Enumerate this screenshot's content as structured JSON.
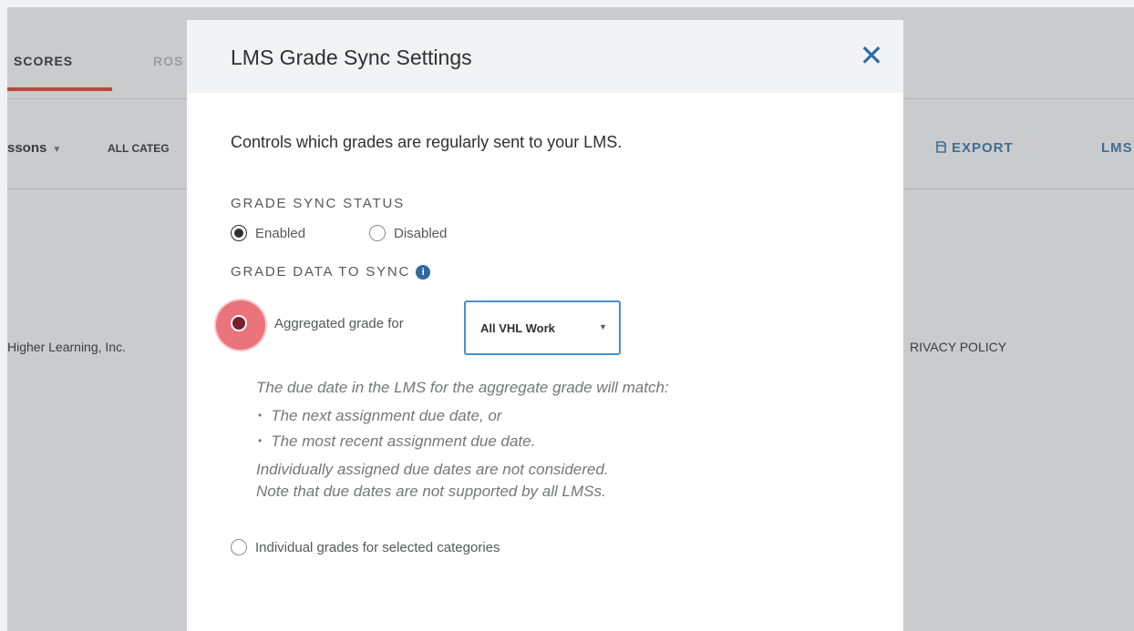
{
  "background_app": {
    "tabs": {
      "scores": "SCORES",
      "roster": "ROS"
    },
    "filters": {
      "lessons": "ssons",
      "categories": "ALL CATEG"
    },
    "toolbar": {
      "export_label": "EXPORT",
      "lms_label": "LMS"
    },
    "footer": {
      "copyright": "Higher Learning, Inc.",
      "privacy": "RIVACY POLICY"
    }
  },
  "dialog": {
    "title": "LMS Grade Sync Settings",
    "close_label": "✕",
    "intro": "Controls which grades are regularly sent to your LMS.",
    "grade_sync_status": {
      "label": "GRADE SYNC STATUS",
      "options": [
        {
          "label": "Enabled",
          "selected": true
        },
        {
          "label": "Disabled",
          "selected": false
        }
      ]
    },
    "grade_data": {
      "label": "GRADE DATA TO SYNC",
      "info_icon": "i",
      "aggregated_option": {
        "label": "Aggregated grade for",
        "selected": true
      },
      "aggregate_select": {
        "value": "All VHL Work"
      },
      "notes": {
        "line1": "The due date in the LMS for the aggregate grade will match:",
        "bullet1": "The next assignment due date, or",
        "bullet2": "The most recent assignment due date.",
        "line2": "Individually assigned due dates are not considered.",
        "line3": "Note that due dates are not supported by all LMSs."
      },
      "individual_option": {
        "label": "Individual grades for selected categories",
        "selected": false
      }
    }
  },
  "colors": {
    "accent_blue": "#2d6aa3",
    "tab_underline": "#b9493c",
    "click_highlight": "#e85b64",
    "overlay": "#c9cbcd"
  },
  "icons": {
    "close": "close-icon",
    "info": "info-icon",
    "export": "export-icon",
    "dropdown": "chevron-down-icon"
  }
}
